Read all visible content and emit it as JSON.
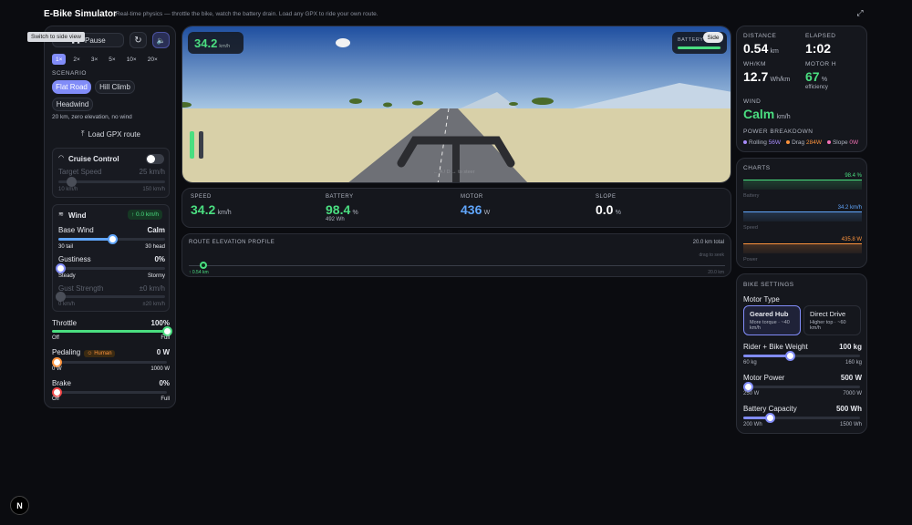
{
  "header": {
    "title": "E-Bike Simulator",
    "subtitle": "Real-time physics — throttle the bike, watch the battery drain. Load any GPX to ride your own route.",
    "tooltip": "Switch to side view"
  },
  "controls": {
    "pause_label": "Pause",
    "speeds": [
      "1×",
      "2×",
      "3×",
      "5×",
      "10×",
      "20×"
    ],
    "scenario_label": "SCENARIO",
    "scenarios": [
      "Flat Road",
      "Hill Climb",
      "Headwind"
    ],
    "scenario_desc": "20 km, zero elevation, no wind",
    "gpx_label": "Load GPX route",
    "cruise": {
      "title": "Cruise Control",
      "target_label": "Target Speed",
      "target_value": "25 km/h",
      "min": "10 km/h",
      "max": "150 km/h"
    },
    "wind": {
      "title": "Wind",
      "badge": "↑ 0.0 km/h",
      "base_label": "Base Wind",
      "base_value": "Calm",
      "base_min": "30 tail",
      "base_max": "30 head",
      "gust_label": "Gustiness",
      "gust_value": "0%",
      "gust_min": "Steady",
      "gust_max": "Stormy",
      "strength_label": "Gust Strength",
      "strength_value": "±0 km/h",
      "strength_min": "0 km/h",
      "strength_max": "±20 km/h"
    },
    "throttle": {
      "label": "Throttle",
      "value": "100%",
      "min": "Off",
      "max": "Full"
    },
    "pedaling": {
      "label": "Pedaling",
      "badge": "Human",
      "value": "0 W",
      "min": "0 W",
      "max": "1000 W"
    },
    "brake": {
      "label": "Brake",
      "value": "0%",
      "min": "Off",
      "max": "Full"
    }
  },
  "view": {
    "speed_value": "34.2",
    "speed_unit": "km/h",
    "battery_label": "BATTERY",
    "side_label": "Side",
    "steer_hint": "← A / D → to steer"
  },
  "readouts": [
    {
      "label": "SPEED",
      "value": "34.2",
      "unit": "km/h",
      "sub": "",
      "color": "#4ade80"
    },
    {
      "label": "BATTERY",
      "value": "98.4",
      "unit": "%",
      "sub": "492 Wh",
      "color": "#4ade80"
    },
    {
      "label": "MOTOR",
      "value": "436",
      "unit": "W",
      "sub": "",
      "color": "#60a5fa"
    },
    {
      "label": "SLOPE",
      "value": "0.0",
      "unit": "%",
      "sub": "",
      "color": "#ffffff"
    }
  ],
  "profile": {
    "title": "ROUTE ELEVATION PROFILE",
    "total": "20.0 km total",
    "hint": "drag to seek",
    "pos_label": "0.54 km",
    "end_label": "20.0 km",
    "progress": 0.027
  },
  "stats": {
    "distance_label": "DISTANCE",
    "distance_value": "0.54",
    "distance_unit": "km",
    "elapsed_label": "ELAPSED",
    "elapsed_value": "1:02",
    "whkm_label": "WH/KM",
    "whkm_value": "12.7",
    "whkm_unit": "Wh/km",
    "motor_label": "MOTOR η",
    "motor_value": "67",
    "motor_unit": "%",
    "motor_sub": "efficiency",
    "wind_label": "WIND",
    "wind_value": "Calm",
    "wind_unit": "km/h",
    "power_label": "POWER BREAKDOWN",
    "power": [
      {
        "name": "Rolling",
        "value": "56W",
        "color": "#a78bfa"
      },
      {
        "name": "Drag",
        "value": "284W",
        "color": "#fb923c"
      },
      {
        "name": "Slope",
        "value": "0W",
        "color": "#f472b6"
      }
    ]
  },
  "charts": {
    "title": "CHARTS",
    "items": [
      {
        "name": "Battery",
        "value": "98.4 %",
        "color": "#4ade80"
      },
      {
        "name": "Speed",
        "value": "34.2 km/h",
        "color": "#60a5fa"
      },
      {
        "name": "Power",
        "value": "435.8 W",
        "color": "#fb923c"
      }
    ]
  },
  "bike": {
    "title": "BIKE SETTINGS",
    "motor_type_label": "Motor Type",
    "geared_title": "Geared Hub",
    "geared_desc": "More torque · ~40 km/h",
    "direct_title": "Direct Drive",
    "direct_desc": "Higher top · ~60 km/h",
    "weight_label": "Rider + Bike Weight",
    "weight_value": "100 kg",
    "weight_min": "60 kg",
    "weight_max": "160 kg",
    "weight_level": 0.4,
    "power_label": "Motor Power",
    "power_value": "500 W",
    "power_min": "250 W",
    "power_max": "7000 W",
    "power_level": 0.04,
    "cap_label": "Battery Capacity",
    "cap_value": "500 Wh",
    "cap_min": "200 Wh",
    "cap_max": "1500 Wh",
    "cap_level": 0.23
  },
  "levels": {
    "throttle": 1.0,
    "base_wind": 0.5,
    "battery": 0.984
  },
  "colors": {
    "accent": "#818cf8",
    "green": "#4ade80",
    "blue": "#60a5fa",
    "orange": "#fb923c"
  }
}
